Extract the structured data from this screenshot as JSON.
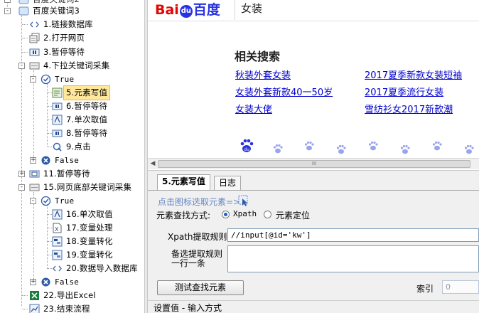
{
  "tree": {
    "root_label": "百度关键词3",
    "items": [
      {
        "label": "1.链接数据库",
        "icon": "link-icon"
      },
      {
        "label": "2.打开网页",
        "icon": "open-page-icon"
      },
      {
        "label": "3.暂停等待",
        "icon": "pause-icon"
      },
      {
        "label": "4.下拉关键词采集",
        "icon": "loop-icon"
      },
      {
        "label": "True",
        "icon": "check-icon"
      },
      {
        "label": "5.元素写值",
        "icon": "write-value-icon"
      },
      {
        "label": "6.暂停等待",
        "icon": "pause-icon"
      },
      {
        "label": "7.单次取值",
        "icon": "get-value-icon"
      },
      {
        "label": "8.暂停等待",
        "icon": "pause-icon"
      },
      {
        "label": "9.点击",
        "icon": "click-icon"
      },
      {
        "label": "False",
        "icon": "cross-icon"
      },
      {
        "label": "11.暂停等待",
        "icon": "pause-icon"
      },
      {
        "label": "15.网页底部关键词采集",
        "icon": "loop-icon"
      },
      {
        "label": "True",
        "icon": "check-icon"
      },
      {
        "label": "16.单次取值",
        "icon": "get-value-icon"
      },
      {
        "label": "17.变量处理",
        "icon": "variable-icon"
      },
      {
        "label": "18.变量转化",
        "icon": "convert-icon"
      },
      {
        "label": "19.变量转化",
        "icon": "convert-icon"
      },
      {
        "label": "20.数据导入数据库",
        "icon": "link-icon"
      },
      {
        "label": "False",
        "icon": "cross-icon"
      },
      {
        "label": "22.导出Excel",
        "icon": "excel-icon"
      },
      {
        "label": "23.结束流程",
        "icon": "chart-icon"
      }
    ]
  },
  "browser": {
    "logo_left": "Bai",
    "logo_du": "du",
    "logo_right": "百度",
    "query": "女装",
    "related_title": "相关搜索",
    "related": [
      "秋装外套女装",
      "2017夏季新款女装短袖",
      "女装外套新款40一50岁",
      "2017夏季流行女装",
      "女装大佬",
      "雪纺衫女2017新款潮"
    ],
    "scroll_thumb_text": "III",
    "paw_color": "#2932e1",
    "logo_color": "#e10601"
  },
  "props": {
    "tabs": [
      "5.元素写值",
      "日志"
    ],
    "pick_link": "点击图标选取元素=>",
    "find_method_label": "元素查找方式:",
    "option_xpath": "Xpath",
    "option_element": "元素定位",
    "xpath_label": "Xpath提取规则",
    "xpath_value": "//input[@id='kw']",
    "alt_label_line1": "备选提取规则",
    "alt_label_line2": "一行一条",
    "test_button": "测试查找元素",
    "index_label": "索引",
    "index_value": "0",
    "set_value_label": "设置值 - 输入方式"
  }
}
